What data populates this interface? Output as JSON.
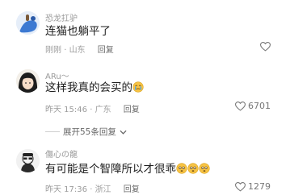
{
  "comments": [
    {
      "username": "恐龙扛驴",
      "text": "连猫也躺平了",
      "time": "刚刚",
      "location": "山东",
      "reply_label": "回复",
      "likes": ""
    },
    {
      "username": "ARu～",
      "text": "这样我真的会买的",
      "emoji": "crying-face-emoji",
      "time": "昨天 15:46",
      "location": "广东",
      "reply_label": "回复",
      "likes": "6701"
    },
    {
      "username": "傷心の龍",
      "text": "有可能是个智障所以才很乖",
      "emoji": "worried-face-emoji",
      "time": "昨天 17:36",
      "location": "浙江",
      "reply_label": "回复",
      "likes": "1279"
    }
  ],
  "expand_label": "展开55条回复",
  "separator": "·",
  "colors": {
    "emoji_yellow": "#f7c344",
    "like_gray": "#777777"
  }
}
